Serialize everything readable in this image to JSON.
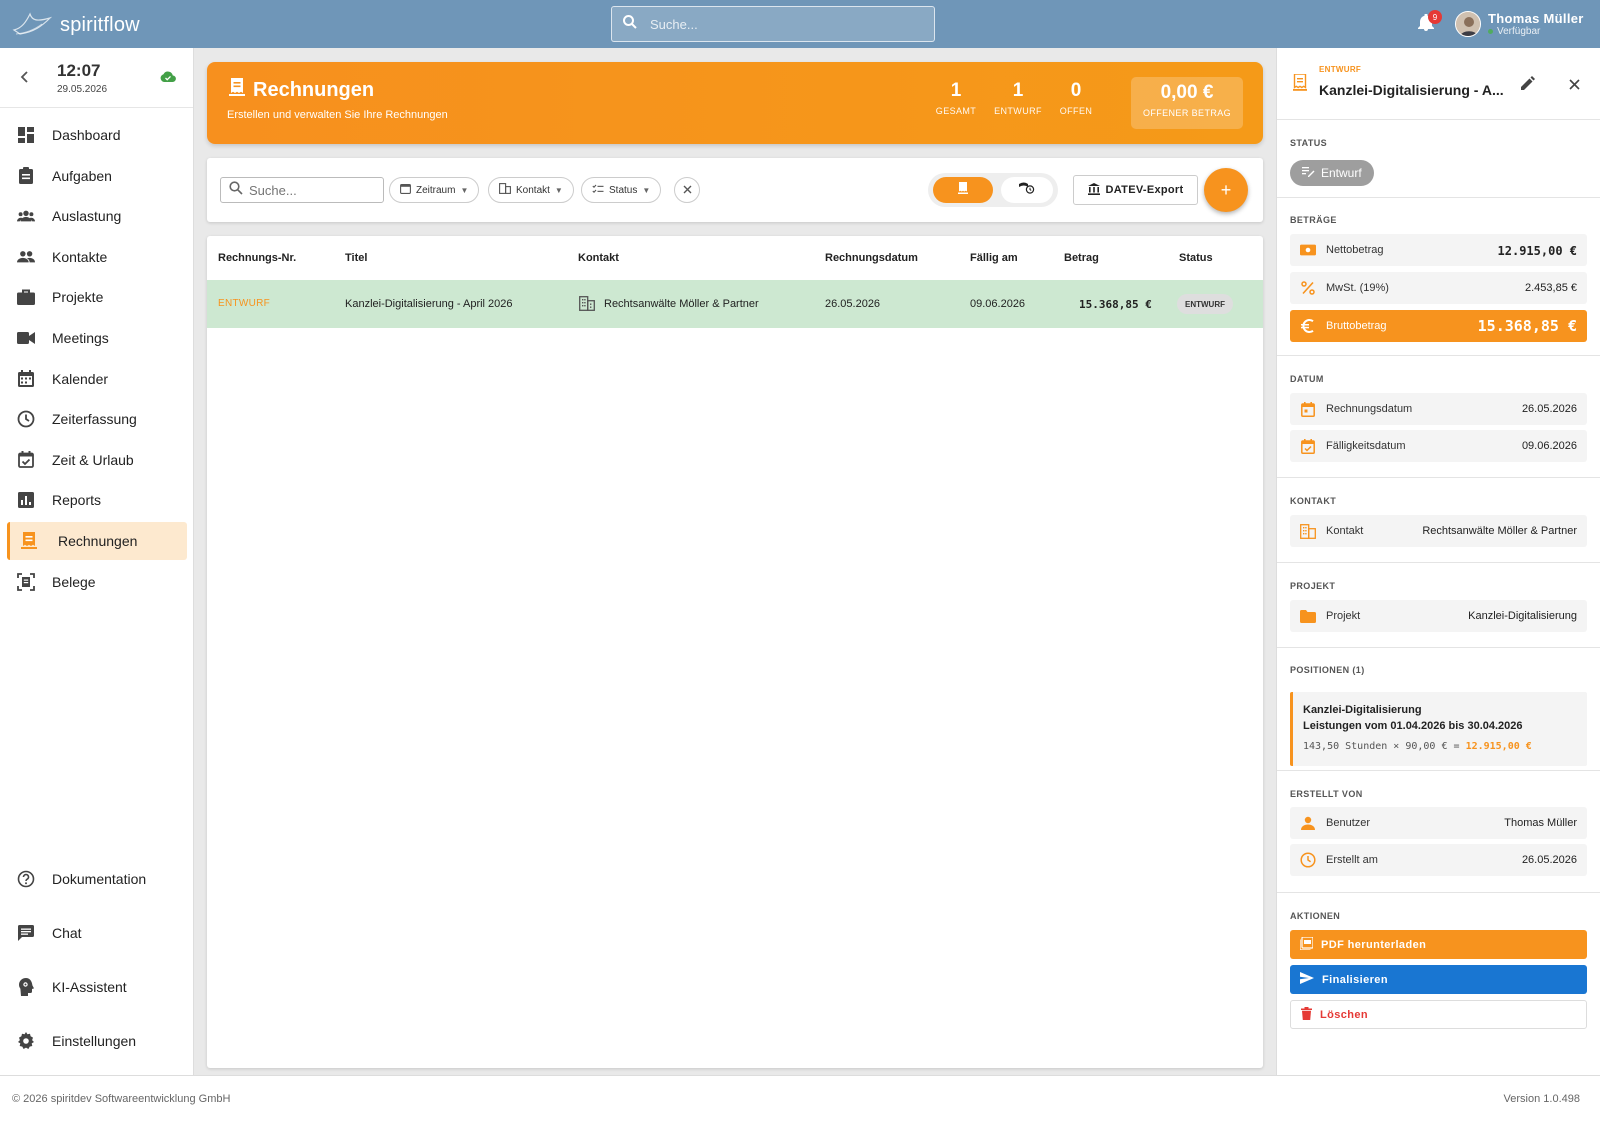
{
  "app": {
    "name": "spiritflow"
  },
  "topbar": {
    "search_placeholder": "Suche...",
    "notification_count": "9",
    "user_name": "Thomas Müller",
    "user_status": "Verfügbar"
  },
  "sidebar": {
    "time": "12:07",
    "date": "29.05.2026",
    "items": [
      {
        "label": "Dashboard",
        "icon": "dashboard-icon"
      },
      {
        "label": "Aufgaben",
        "icon": "clipboard-icon"
      },
      {
        "label": "Auslastung",
        "icon": "group-icon"
      },
      {
        "label": "Kontakte",
        "icon": "people-icon"
      },
      {
        "label": "Projekte",
        "icon": "briefcase-icon"
      },
      {
        "label": "Meetings",
        "icon": "video-icon"
      },
      {
        "label": "Kalender",
        "icon": "calendar-icon"
      },
      {
        "label": "Zeiterfassung",
        "icon": "clock-icon"
      },
      {
        "label": "Zeit & Urlaub",
        "icon": "event-check-icon"
      },
      {
        "label": "Reports",
        "icon": "bar-chart-icon"
      },
      {
        "label": "Rechnungen",
        "icon": "receipt-icon",
        "active": true
      },
      {
        "label": "Belege",
        "icon": "document-scan-icon"
      }
    ],
    "bottom_items": [
      {
        "label": "Dokumentation",
        "icon": "help-icon"
      },
      {
        "label": "Chat",
        "icon": "chat-icon"
      },
      {
        "label": "KI-Assistent",
        "icon": "psychology-icon"
      },
      {
        "label": "Einstellungen",
        "icon": "settings-icon"
      }
    ]
  },
  "hero": {
    "title": "Rechnungen",
    "subtitle": "Erstellen und verwalten Sie Ihre Rechnungen",
    "stats": [
      {
        "value": "1",
        "label": "GESAMT"
      },
      {
        "value": "1",
        "label": "ENTWURF"
      },
      {
        "value": "0",
        "label": "OFFEN"
      }
    ],
    "open_amount": {
      "value": "0,00 €",
      "label": "OFFENER BETRAG"
    }
  },
  "toolbar": {
    "search_placeholder": "Suche...",
    "filter_period": "Zeitraum",
    "filter_contact": "Kontakt",
    "filter_status": "Status",
    "datev_label": "DATEV-Export",
    "add_label": "+"
  },
  "table": {
    "headers": [
      "Rechnungs-Nr.",
      "Titel",
      "Kontakt",
      "Rechnungsdatum",
      "Fällig am",
      "Betrag",
      "Status"
    ],
    "rows": [
      {
        "number": "ENTWURF",
        "title": "Kanzlei-Digitalisierung - April 2026",
        "contact": "Rechtsanwälte Möller & Partner",
        "invoice_date": "26.05.2026",
        "due_date": "09.06.2026",
        "amount": "15.368,85 €",
        "status": "ENTWURF"
      }
    ]
  },
  "panel": {
    "badge": "ENTWURF",
    "title": "Kanzlei-Digitalisierung - A...",
    "status_title": "STATUS",
    "status_value": "Entwurf",
    "amounts_title": "BETRÄGE",
    "net_label": "Nettobetrag",
    "net_value": "12.915,00 €",
    "vat_label": "MwSt. (19%)",
    "vat_value": "2.453,85 €",
    "gross_label": "Bruttobetrag",
    "gross_value": "15.368,85 €",
    "date_title": "DATUM",
    "invoice_date_label": "Rechnungsdatum",
    "invoice_date_value": "26.05.2026",
    "due_date_label": "Fälligkeitsdatum",
    "due_date_value": "09.06.2026",
    "contact_title": "KONTAKT",
    "contact_label": "Kontakt",
    "contact_value": "Rechtsanwälte Möller & Partner",
    "project_title": "PROJEKT",
    "project_label": "Projekt",
    "project_value": "Kanzlei-Digitalisierung",
    "positions_title": "POSITIONEN (1)",
    "position_title": "Kanzlei-Digitalisierung",
    "position_desc": "Leistungen vom 01.04.2026 bis 30.04.2026",
    "position_calc": "143,50 Stunden × 90,00 € = ",
    "position_total": "12.915,00 €",
    "created_title": "ERSTELLT VON",
    "user_label": "Benutzer",
    "user_value": "Thomas Müller",
    "created_label": "Erstellt am",
    "created_value": "26.05.2026",
    "actions_title": "AKTIONEN",
    "pdf_label": "PDF herunterladen",
    "finalize_label": "Finalisieren",
    "delete_label": "Löschen"
  },
  "footer": {
    "copyright": "© 2026 spiritdev Softwareentwicklung GmbH",
    "version": "Version 1.0.498"
  },
  "colors": {
    "accent": "#f7931e",
    "topbar": "#6f96b8",
    "primary": "#1976d2",
    "danger": "#e53935",
    "row_highlight": "#cde8d1"
  }
}
